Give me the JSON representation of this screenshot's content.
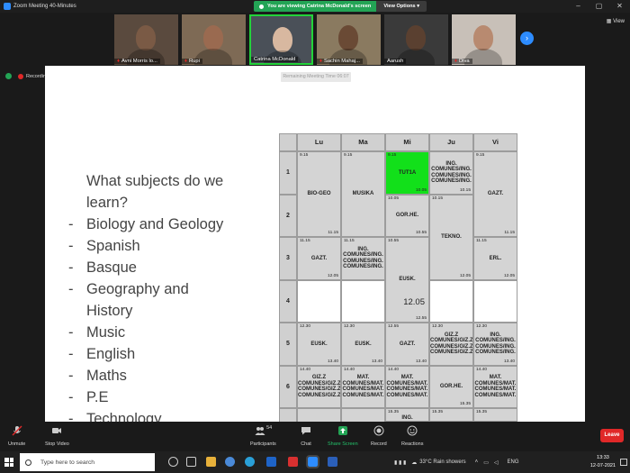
{
  "window": {
    "title": "Zoom Meeting 40-Minutes",
    "viewing_banner": "You are viewing Catrina McDonald's screen",
    "view_options": "View Options",
    "view_button": "View"
  },
  "participants": [
    {
      "name": "Avni Morris lo...",
      "muted": true,
      "bg": "#5a4a3e",
      "face": "#7a5a45"
    },
    {
      "name": "Rupi",
      "muted": true,
      "bg": "#7e6a55",
      "face": "#9a6a50"
    },
    {
      "name": "Catrina McDonald",
      "muted": false,
      "bg": "#4a5058",
      "face": "#d8b8a0"
    },
    {
      "name": "Sachin Mahaj...",
      "muted": true,
      "bg": "#8a7a60",
      "face": "#6a4a35"
    },
    {
      "name": "Aarush",
      "muted": false,
      "bg": "#3a3a3a",
      "face": "#5a4030"
    },
    {
      "name": "Diva",
      "muted": true,
      "bg": "#c8c0b8",
      "face": "#b88a70"
    }
  ],
  "recording_label": "Recording...",
  "remaining_time": "Remaining Meeting Time 06:07",
  "slide": {
    "question": [
      "What subjects do we",
      "learn?"
    ],
    "subjects": [
      [
        "Biology and Geology"
      ],
      [
        "Spanish"
      ],
      [
        "Basque"
      ],
      [
        "Geography and",
        "History"
      ],
      [
        "Music"
      ],
      [
        "English"
      ],
      [
        "Maths"
      ],
      [
        "P.E"
      ],
      [
        "Technology"
      ]
    ]
  },
  "timetable": {
    "days": [
      "Lu",
      "Ma",
      "Mi",
      "Ju",
      "Vi"
    ],
    "periods": [
      "1",
      "2",
      "3",
      "4",
      "5",
      "6"
    ],
    "cells": [
      {
        "col": 0,
        "row": 0,
        "span": 2,
        "start": "9.15",
        "end": "11.15",
        "subject": [
          "BIO-GEO"
        ],
        "style": ""
      },
      {
        "col": 1,
        "row": 0,
        "span": 2,
        "start": "9.15",
        "end": "",
        "subject": [
          "MUSIKA"
        ],
        "style": ""
      },
      {
        "col": 2,
        "row": 0,
        "span": 1,
        "start": "9.15",
        "end": "10.05",
        "subject": [
          "TUT1A"
        ],
        "style": "green"
      },
      {
        "col": 2,
        "row": 1,
        "span": 1,
        "start": "10.05",
        "end": "10.55",
        "subject": [
          "GOR.HE."
        ],
        "style": ""
      },
      {
        "col": 3,
        "row": 0,
        "span": 1,
        "start": "",
        "end": "10.15",
        "subject": [
          "ING.",
          "COMUNES/ING.",
          "COMUNES/ING.",
          "COMUNES/ING."
        ],
        "style": ""
      },
      {
        "col": 3,
        "row": 1,
        "span": 2,
        "start": "10.15",
        "end": "12.05",
        "subject": [
          "TEKNO."
        ],
        "style": ""
      },
      {
        "col": 4,
        "row": 0,
        "span": 2,
        "start": "9.15",
        "end": "11.15",
        "subject": [
          "GAZT."
        ],
        "style": ""
      },
      {
        "col": 0,
        "row": 2,
        "span": 1,
        "start": "11.15",
        "end": "12.05",
        "subject": [
          "GAZT."
        ],
        "style": ""
      },
      {
        "col": 1,
        "row": 2,
        "span": 1,
        "start": "11.15",
        "end": "",
        "subject": [
          "ING.",
          "COMUNES/ING.",
          "COMUNES/ING.",
          "COMUNES/ING."
        ],
        "style": ""
      },
      {
        "col": 2,
        "row": 2,
        "span": 2,
        "start": "10.55",
        "end": "12.55",
        "subject": [
          "EUSK."
        ],
        "big": "12.05",
        "style": ""
      },
      {
        "col": 4,
        "row": 2,
        "span": 1,
        "start": "11.15",
        "end": "12.05",
        "subject": [
          "ERL."
        ],
        "style": ""
      },
      {
        "col": 0,
        "row": 3,
        "span": 1,
        "start": "",
        "end": "",
        "subject": [],
        "style": "white"
      },
      {
        "col": 1,
        "row": 3,
        "span": 1,
        "start": "",
        "end": "",
        "subject": [],
        "style": "white"
      },
      {
        "col": 3,
        "row": 3,
        "span": 1,
        "start": "",
        "end": "",
        "subject": [],
        "style": "white"
      },
      {
        "col": 4,
        "row": 3,
        "span": 1,
        "start": "",
        "end": "",
        "subject": [],
        "style": "white"
      },
      {
        "col": 0,
        "row": 4,
        "span": 1,
        "start": "12.30",
        "end": "13.40",
        "subject": [
          "EUSK."
        ],
        "style": ""
      },
      {
        "col": 1,
        "row": 4,
        "span": 1,
        "start": "12.30",
        "end": "13.40",
        "subject": [
          "EUSK."
        ],
        "style": ""
      },
      {
        "col": 2,
        "row": 4,
        "span": 1,
        "start": "12.55",
        "end": "13.40",
        "subject": [
          "GAZT."
        ],
        "style": ""
      },
      {
        "col": 3,
        "row": 4,
        "span": 1,
        "start": "12.30",
        "end": "",
        "subject": [
          "GIZ.Z",
          "COMUNES/GIZ.Z",
          "COMUNES/GIZ.Z",
          "COMUNES/GIZ.Z"
        ],
        "style": ""
      },
      {
        "col": 4,
        "row": 4,
        "span": 1,
        "start": "12.30",
        "end": "13.40",
        "subject": [
          "ING.",
          "COMUNES/ING.",
          "COMUNES/ING.",
          "COMUNES/ING."
        ],
        "style": ""
      },
      {
        "col": 0,
        "row": 5,
        "span": 1,
        "start": "14.40",
        "end": "",
        "subject": [
          "GIZ.Z",
          "COMUNES/GIZ.Z",
          "COMUNES/GIZ.Z",
          "COMUNES/GIZ.Z"
        ],
        "style": ""
      },
      {
        "col": 1,
        "row": 5,
        "span": 1,
        "start": "14.40",
        "end": "",
        "subject": [
          "MAT.",
          "COMUNES/MAT.",
          "COMUNES/MAT.",
          "COMUNES/MAT."
        ],
        "style": ""
      },
      {
        "col": 2,
        "row": 5,
        "span": 1,
        "start": "14.40",
        "end": "",
        "subject": [
          "MAT.",
          "COMUNES/MAT.",
          "COMUNES/MAT.",
          "COMUNES/MAT."
        ],
        "style": ""
      },
      {
        "col": 3,
        "row": 5,
        "span": 1,
        "start": "",
        "end": "15.35",
        "subject": [
          "GOR.HE."
        ],
        "style": ""
      },
      {
        "col": 4,
        "row": 5,
        "span": 1,
        "start": "14.40",
        "end": "",
        "subject": [
          "MAT.",
          "COMUNES/MAT.",
          "COMUNES/MAT.",
          "COMUNES/MAT."
        ],
        "style": ""
      }
    ],
    "overflow": [
      {
        "col": 2,
        "start": "15.35",
        "subject": "ING."
      },
      {
        "col": 3,
        "start": "15.35",
        "subject": ""
      },
      {
        "col": 4,
        "start": "15.35",
        "subject": ""
      }
    ]
  },
  "toolbar": {
    "unmute": "Unmute",
    "stop_video": "Stop Video",
    "participants_count": "54",
    "participants": "Participants",
    "chat": "Chat",
    "share_screen": "Share Screen",
    "record": "Record",
    "reactions": "Reactions",
    "leave": "Leave"
  },
  "taskbar": {
    "search_placeholder": "Type here to search",
    "weather": "33°C  Rain showers",
    "language": "ENG",
    "time": "13:33",
    "date": "12-07-2021"
  },
  "colors": {
    "zoom_blue": "#2d8cff",
    "banner_green": "#23a455",
    "leave_red": "#e02828",
    "cell_green": "#12e01a"
  }
}
